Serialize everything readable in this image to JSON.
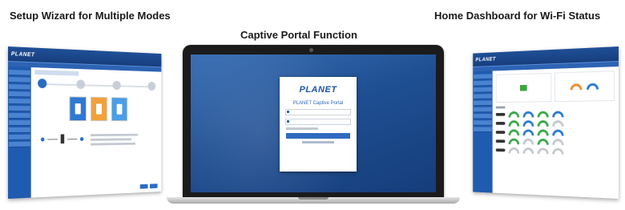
{
  "captions": {
    "left": "Setup Wizard for Multiple Modes",
    "center": "Captive Portal Function",
    "right": "Home Dashboard for Wi-Fi Status"
  },
  "left_panel": {
    "logo": "PLANET"
  },
  "right_panel": {
    "logo": "PLANET"
  },
  "laptop": {
    "portal": {
      "brand": "PLANET",
      "title": "PLANET Captive Portal"
    }
  },
  "colors": {
    "brand_blue": "#1f4f97",
    "screen_blue": "#1f4f93",
    "accent_orange": "#f08c2e",
    "accent_green": "#35a84a"
  }
}
